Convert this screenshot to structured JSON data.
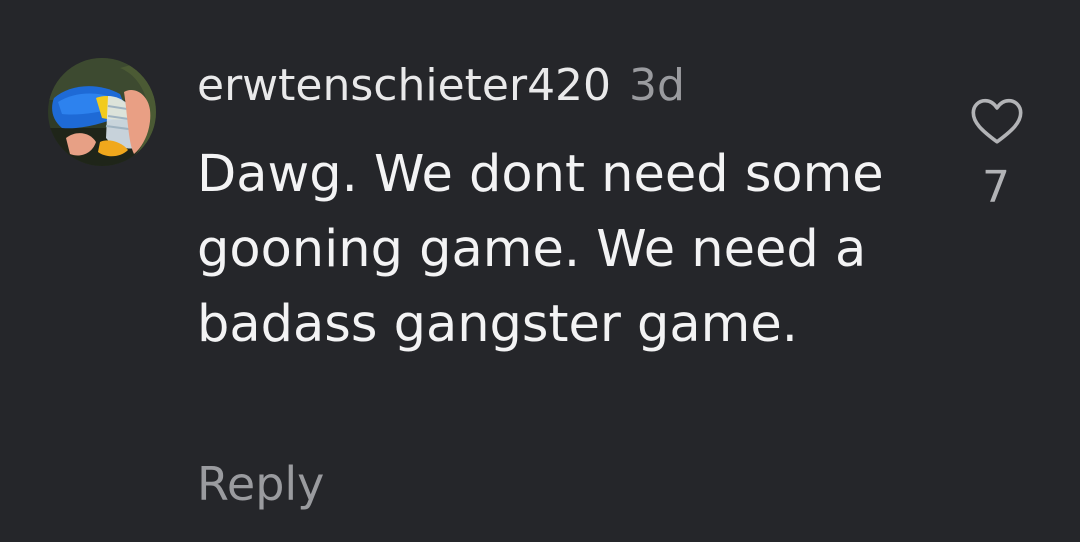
{
  "comment": {
    "username": "erwtenschieter420",
    "timestamp": "3d",
    "text": "Dawg. We dont need some gooning game. We need a badass gangster game.",
    "reply_label": "Reply",
    "like_count": "7",
    "avatar_icon": "avatar-photo",
    "like_icon": "heart-outline-icon"
  },
  "colors": {
    "background": "#25262a",
    "username": "#e9e9ea",
    "body_text": "#f3f3f4",
    "secondary_text": "#9a9b9f",
    "like_icon": "#b2b3b6"
  }
}
